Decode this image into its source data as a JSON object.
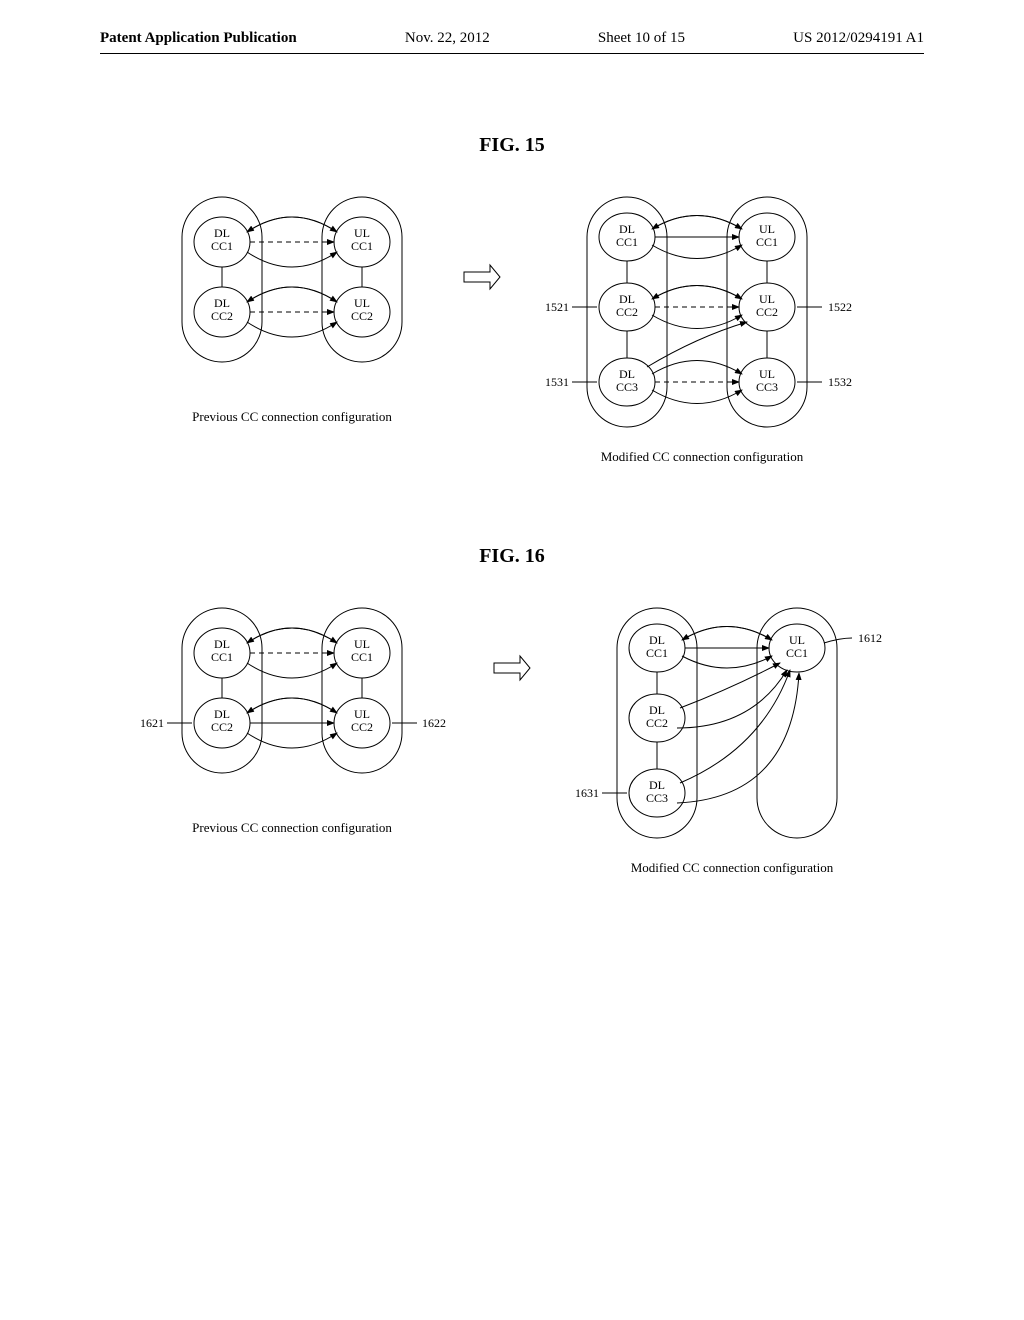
{
  "header": {
    "left": "Patent Application Publication",
    "date": "Nov. 22, 2012",
    "sheet": "Sheet 10 of 15",
    "pubno": "US 2012/0294191 A1"
  },
  "fig15": {
    "title": "FIG. 15",
    "prev_caption": "Previous CC connection configuration",
    "mod_caption": "Modified CC connection configuration",
    "dl": "DL",
    "ul": "UL",
    "cc1": "CC1",
    "cc2": "CC2",
    "cc3": "CC3",
    "ref": {
      "1521": "1521",
      "1522": "1522",
      "1531": "1531",
      "1532": "1532"
    }
  },
  "fig16": {
    "title": "FIG. 16",
    "prev_caption": "Previous CC connection configuration",
    "mod_caption": "Modified CC connection configuration",
    "dl": "DL",
    "ul": "UL",
    "cc1": "CC1",
    "cc2": "CC2",
    "cc3": "CC3",
    "ref": {
      "1612": "1612",
      "1621": "1621",
      "1622": "1622",
      "1631": "1631"
    }
  }
}
